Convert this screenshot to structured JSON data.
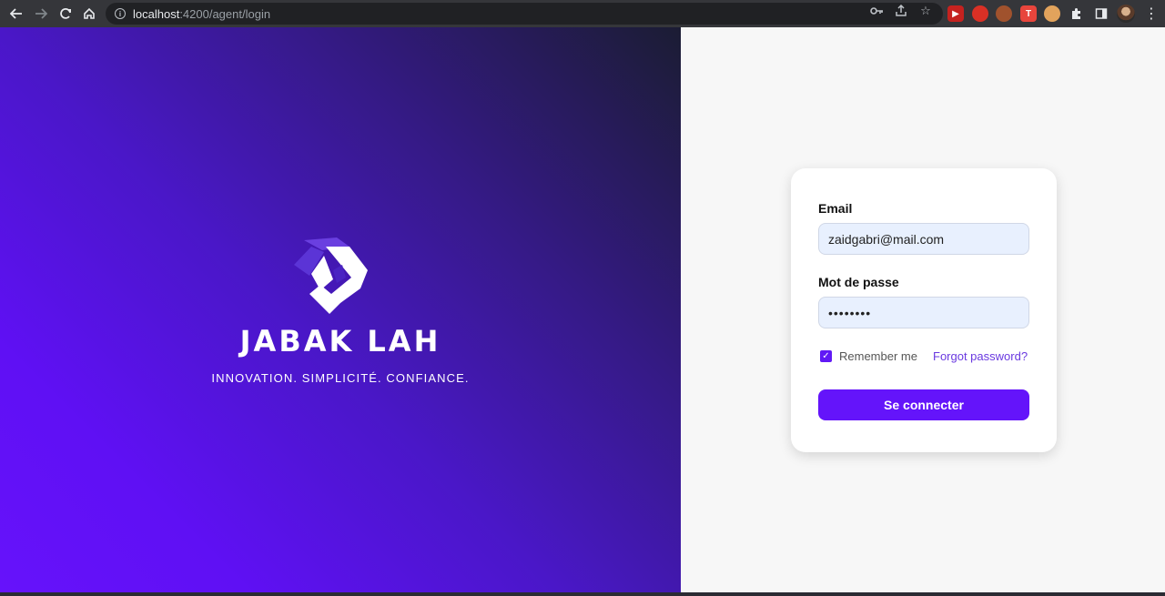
{
  "browser": {
    "url_host": "localhost",
    "url_path": ":4200/agent/login",
    "nav_icons": [
      "back-icon",
      "forward-icon",
      "reload-icon",
      "home-icon"
    ],
    "omnibox_icons": [
      "key-icon",
      "share-icon",
      "bookmark-star-icon"
    ],
    "extensions": [
      "extension-red-play",
      "extension-red-circle",
      "extension-cookie",
      "extension-red-t",
      "extension-cookie-2",
      "extensions-puzzle",
      "side-panel-icon"
    ]
  },
  "brand": {
    "name": "JABAK LAH",
    "tagline": "INNOVATION. SIMPLICITÉ. CONFIANCE."
  },
  "login": {
    "email_label": "Email",
    "email_value": "zaidgabri@mail.com",
    "password_label": "Mot de passe",
    "password_value": "••••••••",
    "remember_label": "Remember me",
    "remember_checked": true,
    "forgot_label": "Forgot password?",
    "submit_label": "Se connecter"
  },
  "colors": {
    "accent": "#6414fa",
    "link": "#6a39e0",
    "input_bg": "#e8f0fe"
  }
}
